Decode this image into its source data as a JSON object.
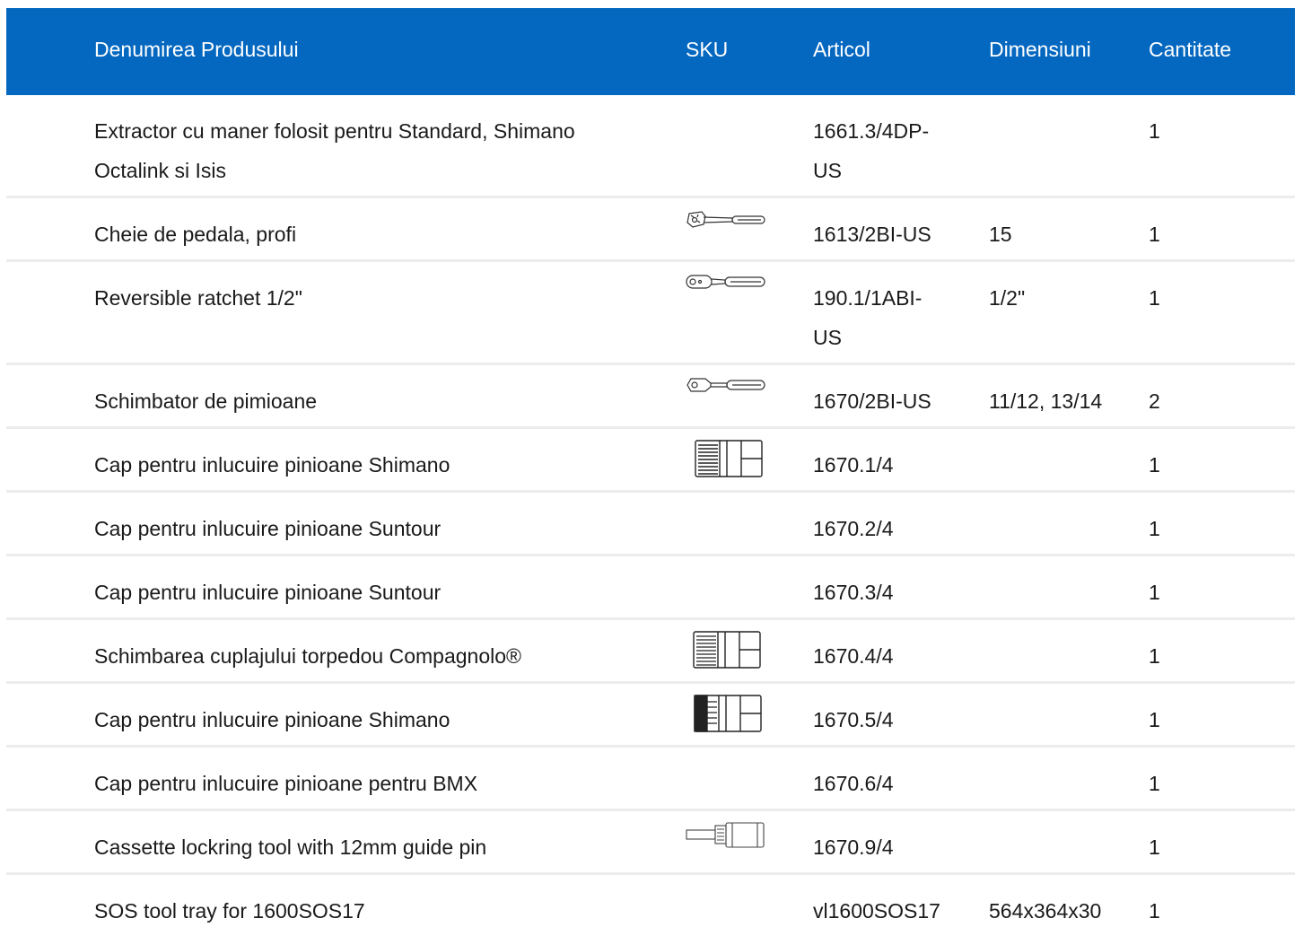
{
  "header": {
    "name": "Denumirea Produsului",
    "sku": "SKU",
    "article": "Articol",
    "dimensions": "Dimensiuni",
    "quantity": "Cantitate"
  },
  "rows": [
    {
      "name": "Extractor cu maner folosit pentru Standard, Shimano\nOctalink si Isis",
      "icon": "",
      "article": "1661.3/4DP-\nUS",
      "dimensions": "",
      "quantity": "1"
    },
    {
      "name": "Cheie de pedala, profi",
      "icon": "pedal-wrench-icon",
      "article": "1613/2BI-US",
      "dimensions": "15",
      "quantity": "1"
    },
    {
      "name": "Reversible ratchet 1/2\"",
      "icon": "ratchet-icon",
      "article": "190.1/1ABI-\nUS",
      "dimensions": "1/2\"",
      "quantity": "1"
    },
    {
      "name": "Schimbator de pimioane",
      "icon": "chain-whip-icon",
      "article": "1670/2BI-US",
      "dimensions": "11/12, 13/14",
      "quantity": "2"
    },
    {
      "name": "Cap pentru inlucuire pinioane Shimano",
      "icon": "socket-icon",
      "article": "1670.1/4",
      "dimensions": "",
      "quantity": "1"
    },
    {
      "name": "Cap pentru inlucuire pinioane Suntour",
      "icon": "",
      "article": "1670.2/4",
      "dimensions": "",
      "quantity": "1"
    },
    {
      "name": "Cap pentru inlucuire pinioane Suntour",
      "icon": "",
      "article": "1670.3/4",
      "dimensions": "",
      "quantity": "1"
    },
    {
      "name": "Schimbarea cuplajului torpedou Compagnolo®",
      "icon": "socket-icon",
      "article": "1670.4/4",
      "dimensions": "",
      "quantity": "1"
    },
    {
      "name": "Cap pentru inlucuire pinioane Shimano",
      "icon": "socket-dark-icon",
      "article": "1670.5/4",
      "dimensions": "",
      "quantity": "1"
    },
    {
      "name": "Cap pentru inlucuire pinioane pentru BMX",
      "icon": "",
      "article": "1670.6/4",
      "dimensions": "",
      "quantity": "1"
    },
    {
      "name": "Cassette lockring tool with 12mm guide pin",
      "icon": "lockring-tool-icon",
      "article": "1670.9/4",
      "dimensions": "",
      "quantity": "1"
    },
    {
      "name": "SOS tool tray for 1600SOS17",
      "icon": "",
      "article": "vl1600SOS17",
      "dimensions": "564x364x30",
      "quantity": "1"
    }
  ]
}
